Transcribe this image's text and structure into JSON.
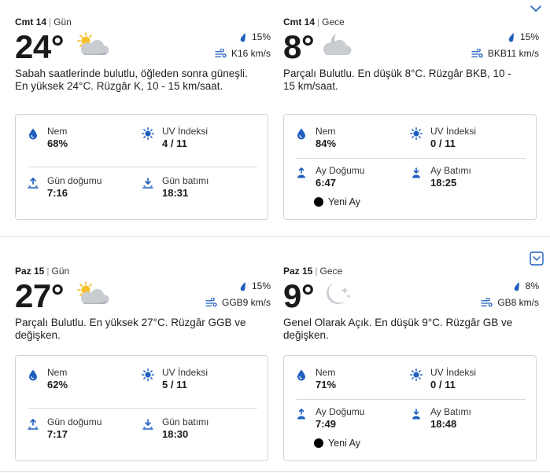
{
  "days": [
    {
      "day": {
        "date": "Cmt 14",
        "period": "Gün",
        "temp": "24°",
        "icon": "partly-sunny-icon",
        "precip": "15%",
        "wind": "K16 km/s",
        "desc": "Sabah saatlerinde bulutlu, öğleden sonra güneşli. En yüksek 24°C. Rüzgâr K, 10 - 15 km/saat.",
        "humidity_label": "Nem",
        "humidity": "68%",
        "uv_label": "UV İndeksi",
        "uv": "4 / 11",
        "rise_label": "Gün doğumu",
        "rise": "7:16",
        "set_label": "Gün batımı",
        "set": "18:31"
      },
      "night": {
        "date": "Cmt 14",
        "period": "Gece",
        "temp": "8°",
        "icon": "partly-cloudy-night-icon",
        "precip": "15%",
        "wind": "BKB11 km/s",
        "desc": "Parçalı Bulutlu. En düşük 8°C. Rüzgâr BKB, 10 - 15 km/saat.",
        "humidity_label": "Nem",
        "humidity": "84%",
        "uv_label": "UV İndeksi",
        "uv": "0 / 11",
        "rise_label": "Ay Doğumu",
        "rise": "6:47",
        "set_label": "Ay Batımı",
        "set": "18:25",
        "moon_phase": "Yeni Ay"
      }
    },
    {
      "day": {
        "date": "Paz 15",
        "period": "Gün",
        "temp": "27°",
        "icon": "partly-sunny-icon",
        "precip": "15%",
        "wind": "GGB9 km/s",
        "desc": "Parçalı Bulutlu. En yüksek 27°C. Rüzgâr GGB ve değişken.",
        "humidity_label": "Nem",
        "humidity": "62%",
        "uv_label": "UV İndeksi",
        "uv": "5 / 11",
        "rise_label": "Gün doğumu",
        "rise": "7:17",
        "set_label": "Gün batımı",
        "set": "18:30"
      },
      "night": {
        "date": "Paz 15",
        "period": "Gece",
        "temp": "9°",
        "icon": "clear-night-icon",
        "precip": "8%",
        "wind": "GB8 km/s",
        "desc": "Genel Olarak Açık. En düşük 9°C. Rüzgâr GB ve değişken.",
        "humidity_label": "Nem",
        "humidity": "71%",
        "uv_label": "UV İndeksi",
        "uv": "0 / 11",
        "rise_label": "Ay Doğumu",
        "rise": "7:49",
        "set_label": "Ay Batımı",
        "set": "18:48",
        "moon_phase": "Yeni Ay"
      }
    }
  ],
  "colors": {
    "accent": "#1f5fbf",
    "divider": "#dadada",
    "card_border": "#d4d4d4"
  }
}
